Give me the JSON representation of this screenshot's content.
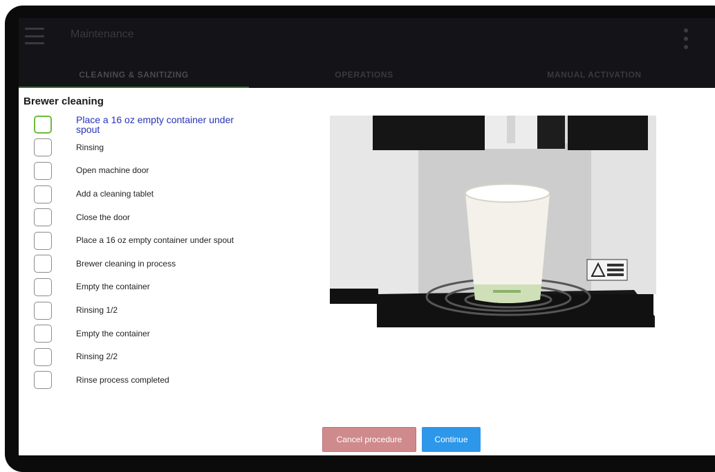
{
  "header": {
    "title": "Maintenance",
    "menu_icon": "hamburger-menu-icon",
    "more_icon": "kebab-more-icon"
  },
  "tabs": [
    {
      "label": "CLEANING & SANITIZING",
      "active": true
    },
    {
      "label": "OPERATIONS",
      "active": false
    },
    {
      "label": "MANUAL ACTIVATION",
      "active": false
    }
  ],
  "section": {
    "title": "Brewer cleaning"
  },
  "steps": [
    {
      "label": "Place a 16 oz empty container under spout",
      "active": true,
      "checked": false
    },
    {
      "label": "Rinsing",
      "active": false,
      "checked": false
    },
    {
      "label": "Open machine door",
      "active": false,
      "checked": false
    },
    {
      "label": "Add a cleaning tablet",
      "active": false,
      "checked": false
    },
    {
      "label": "Close the door",
      "active": false,
      "checked": false
    },
    {
      "label": "Place a 16 oz empty container under spout",
      "active": false,
      "checked": false
    },
    {
      "label": "Brewer cleaning in process",
      "active": false,
      "checked": false
    },
    {
      "label": "Empty the container",
      "active": false,
      "checked": false
    },
    {
      "label": "Rinsing 1/2",
      "active": false,
      "checked": false
    },
    {
      "label": "Empty the container",
      "active": false,
      "checked": false
    },
    {
      "label": "Rinsing 2/2",
      "active": false,
      "checked": false
    },
    {
      "label": "Rinse process completed",
      "active": false,
      "checked": false
    }
  ],
  "buttons": {
    "cancel_label": "Cancel procedure",
    "continue_label": "Continue"
  },
  "colors": {
    "topbar": "#141317",
    "tab_indicator": "#2c6b2a",
    "active_checkbox": "#6dbb3c",
    "active_step_text": "#2633b8",
    "cancel_button": "#cf8a8c",
    "continue_button": "#2d97ea"
  }
}
